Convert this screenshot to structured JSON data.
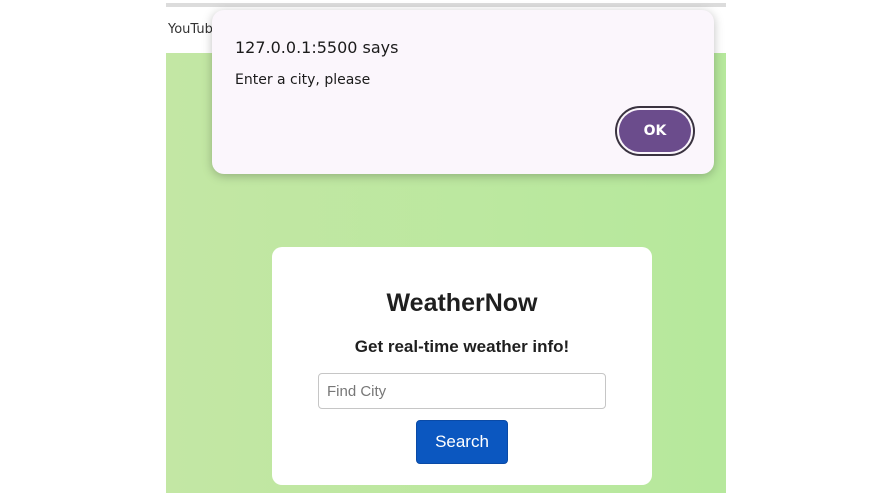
{
  "bookmarks_bar": {
    "items": [
      {
        "label": "YouTub"
      }
    ]
  },
  "alert_dialog": {
    "title": "127.0.0.1:5500 says",
    "message": "Enter a city, please",
    "ok_label": "OK",
    "ok_color": "#6b4c8c"
  },
  "app": {
    "title": "WeatherNow",
    "subtitle": "Get real-time weather info!",
    "search": {
      "placeholder": "Find City",
      "value": ""
    },
    "search_button_label": "Search",
    "search_button_color": "#0b57c0",
    "background_color": "#b9e79f"
  }
}
